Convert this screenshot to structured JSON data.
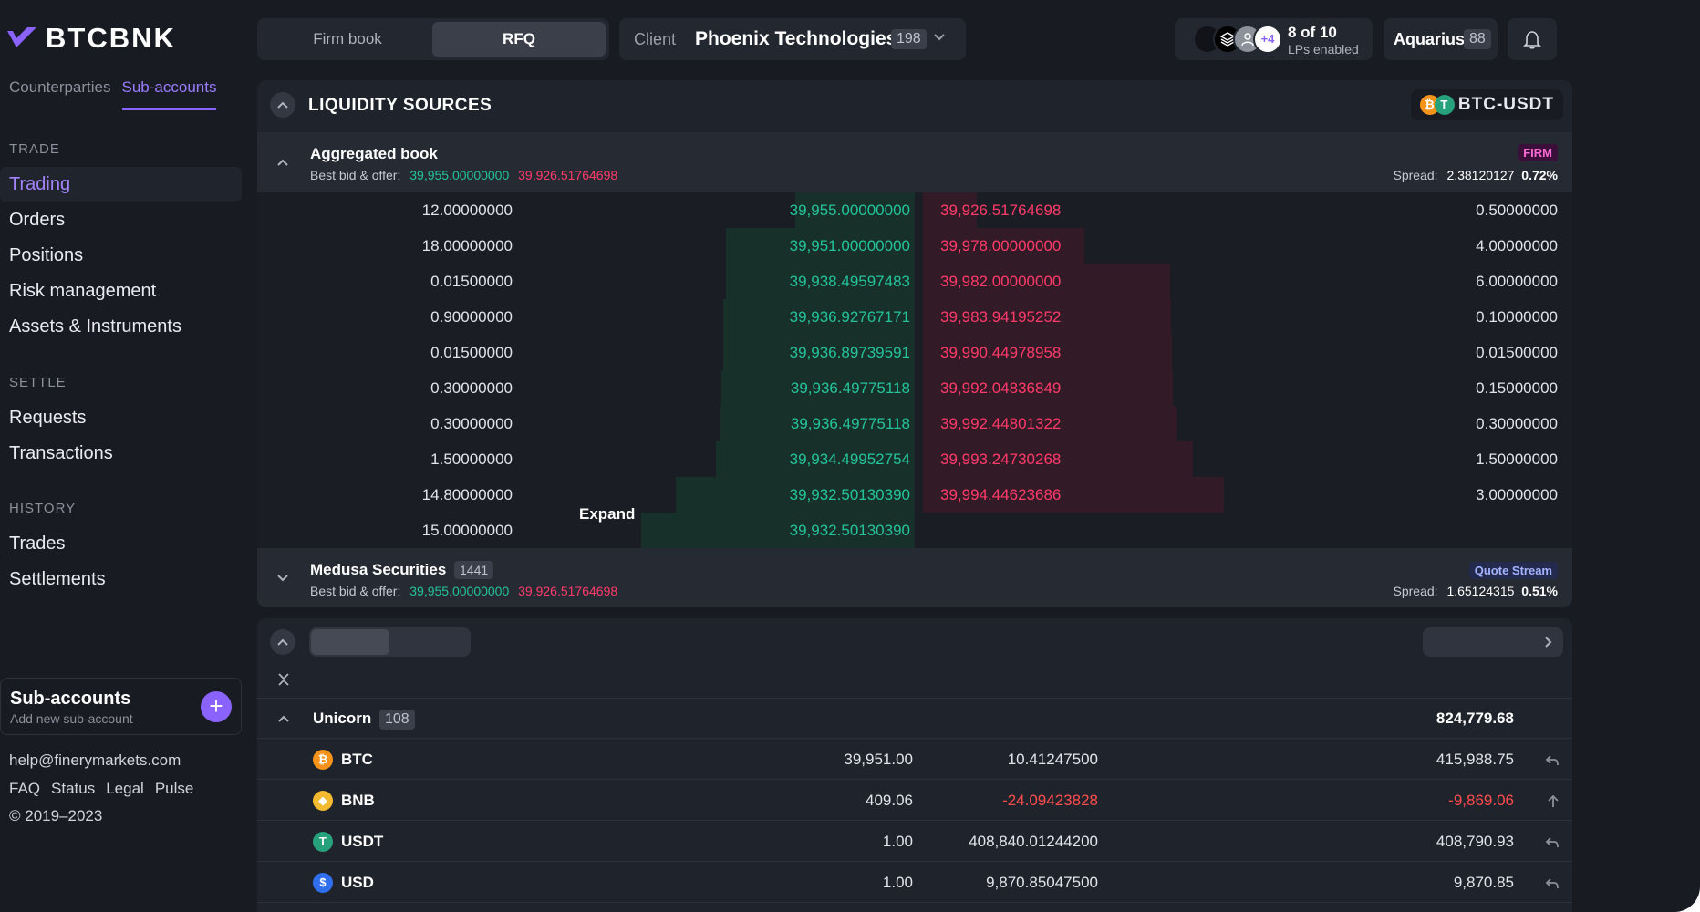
{
  "brand": {
    "name": "BTCBNK",
    "accent": "#8a63ff"
  },
  "sidebar": {
    "tabs": [
      "Counterparties",
      "Sub-accounts"
    ],
    "active_tab": "Sub-accounts",
    "sections": {
      "trade": {
        "title": "TRADE",
        "items": [
          "Trading",
          "Orders",
          "Positions",
          "Risk management",
          "Assets & Instruments"
        ]
      },
      "settle": {
        "title": "SETTLE",
        "items": [
          "Requests",
          "Transactions"
        ]
      },
      "history": {
        "title": "HISTORY",
        "items": [
          "Trades",
          "Settlements"
        ]
      }
    },
    "active_item": "Trading",
    "subaccounts_card": {
      "title": "Sub-accounts",
      "subtitle": "Add new sub-account",
      "add_icon": "plus-icon"
    },
    "footer": {
      "email": "help@finerymarkets.com",
      "links": [
        "FAQ",
        "Status",
        "Legal",
        "Pulse"
      ],
      "copyright": "© 2019–2023"
    }
  },
  "topbar": {
    "mode_options": [
      "Firm book",
      "RFQ"
    ],
    "active_mode": "RFQ",
    "client": {
      "label": "Client",
      "name": "Phoenix Technologies",
      "count": "198"
    },
    "lps": {
      "plus_more": "+4",
      "title": "8 of 10",
      "subtitle": "LPs enabled"
    },
    "account": {
      "name": "Aquarius",
      "count": "88"
    }
  },
  "liquidity": {
    "title": "LIQUIDITY SOURCES",
    "pair": "BTC-USDT",
    "aggregated": {
      "name": "Aggregated book",
      "bbo_label": "Best bid & offer:",
      "best_bid": "39,955.00000000",
      "best_ask": "39,926.51764698",
      "tag": "FIRM",
      "spread_label": "Spread:",
      "spread_value": "2.38120127",
      "spread_pct": "0.72%"
    },
    "book": [
      {
        "bid_size": "12.00000000",
        "bid_price": "39,955.00000000",
        "ask_price": "39,926.51764698",
        "ask_size": "0.50000000"
      },
      {
        "bid_size": "18.00000000",
        "bid_price": "39,951.00000000",
        "ask_price": "39,978.00000000",
        "ask_size": "4.00000000"
      },
      {
        "bid_size": "0.01500000",
        "bid_price": "39,938.49597483",
        "ask_price": "39,982.00000000",
        "ask_size": "6.00000000"
      },
      {
        "bid_size": "0.90000000",
        "bid_price": "39,936.92767171",
        "ask_price": "39,983.94195252",
        "ask_size": "0.10000000"
      },
      {
        "bid_size": "0.01500000",
        "bid_price": "39,936.89739591",
        "ask_price": "39,990.44978958",
        "ask_size": "0.01500000"
      },
      {
        "bid_size": "0.30000000",
        "bid_price": "39,936.49775118",
        "ask_price": "39,992.04836849",
        "ask_size": "0.15000000"
      },
      {
        "bid_size": "0.30000000",
        "bid_price": "39,936.49775118",
        "ask_price": "39,992.44801322",
        "ask_size": "0.30000000"
      },
      {
        "bid_size": "1.50000000",
        "bid_price": "39,934.49952754",
        "ask_price": "39,993.24730268",
        "ask_size": "1.50000000"
      },
      {
        "bid_size": "14.80000000",
        "bid_price": "39,932.50130390",
        "ask_price": "39,994.44623686",
        "ask_size": "3.00000000"
      },
      {
        "bid_size": "15.00000000",
        "bid_price": "39,932.50130390",
        "ask_price": "",
        "ask_size": ""
      }
    ],
    "depth": {
      "bid_cumulative": [
        12.0,
        30.0,
        30.015,
        30.915,
        30.93,
        31.23,
        31.53,
        33.03,
        47.83,
        62.83
      ],
      "ask_cumulative": [
        0.5,
        4.5,
        10.5,
        10.6,
        10.615,
        10.765,
        11.065,
        12.565,
        15.565
      ]
    },
    "expand_label": "Expand",
    "medusa": {
      "name": "Medusa Securities",
      "count": "1441",
      "bbo_label": "Best bid & offer:",
      "best_bid": "39,955.00000000",
      "best_ask": "39,926.51764698",
      "tag": "Quote Stream",
      "spread_label": "Spread:",
      "spread_value": "1.65124315",
      "spread_pct": "0.51%"
    }
  },
  "balances": {
    "group": {
      "name": "Unicorn",
      "count": "108",
      "total": "824,779.68"
    },
    "assets": [
      {
        "symbol": "BTC",
        "icon": "bitcoin-icon",
        "color": "#f7931a",
        "glyph": "₿",
        "price": "39,951.00",
        "qty": "10.41247500",
        "value": "415,988.75",
        "negative": false,
        "action": "return-icon"
      },
      {
        "symbol": "BNB",
        "icon": "bnb-icon",
        "color": "#f3ba2f",
        "glyph": "◆",
        "price": "409.06",
        "qty": "-24.09423828",
        "value": "-9,869.06",
        "negative": true,
        "action": "arrow-up-icon"
      },
      {
        "symbol": "USDT",
        "icon": "tether-icon",
        "color": "#26a17b",
        "glyph": "T",
        "price": "1.00",
        "qty": "408,840.01244200",
        "value": "408,790.93",
        "negative": false,
        "action": "return-icon"
      },
      {
        "symbol": "USD",
        "icon": "dollar-icon",
        "color": "#2f6fed",
        "glyph": "$",
        "price": "1.00",
        "qty": "9,870.85047500",
        "value": "9,870.85",
        "negative": false,
        "action": "return-icon"
      }
    ]
  }
}
